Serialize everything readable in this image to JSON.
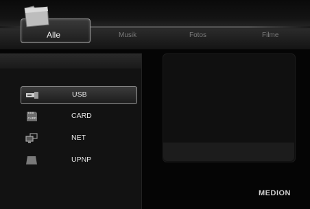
{
  "tabs": [
    {
      "label": "Alle",
      "active": true
    },
    {
      "label": "Musik",
      "active": false
    },
    {
      "label": "Fotos",
      "active": false
    },
    {
      "label": "Filme",
      "active": false
    }
  ],
  "sources": [
    {
      "label": "USB",
      "icon": "usb-icon",
      "selected": true
    },
    {
      "label": "CARD",
      "icon": "sd-card-icon",
      "icon_text": "CARD",
      "selected": false
    },
    {
      "label": "NET",
      "icon": "network-computers-icon",
      "selected": false
    },
    {
      "label": "UPNP",
      "icon": "media-server-icon",
      "selected": false
    }
  ],
  "brand": "MEDION",
  "colors": {
    "background": "#050505",
    "panel": "#121212",
    "highlight_border": "#9a9a9a",
    "text": "#e6e6e6",
    "inactive_tab_text": "#7a7a7a"
  }
}
